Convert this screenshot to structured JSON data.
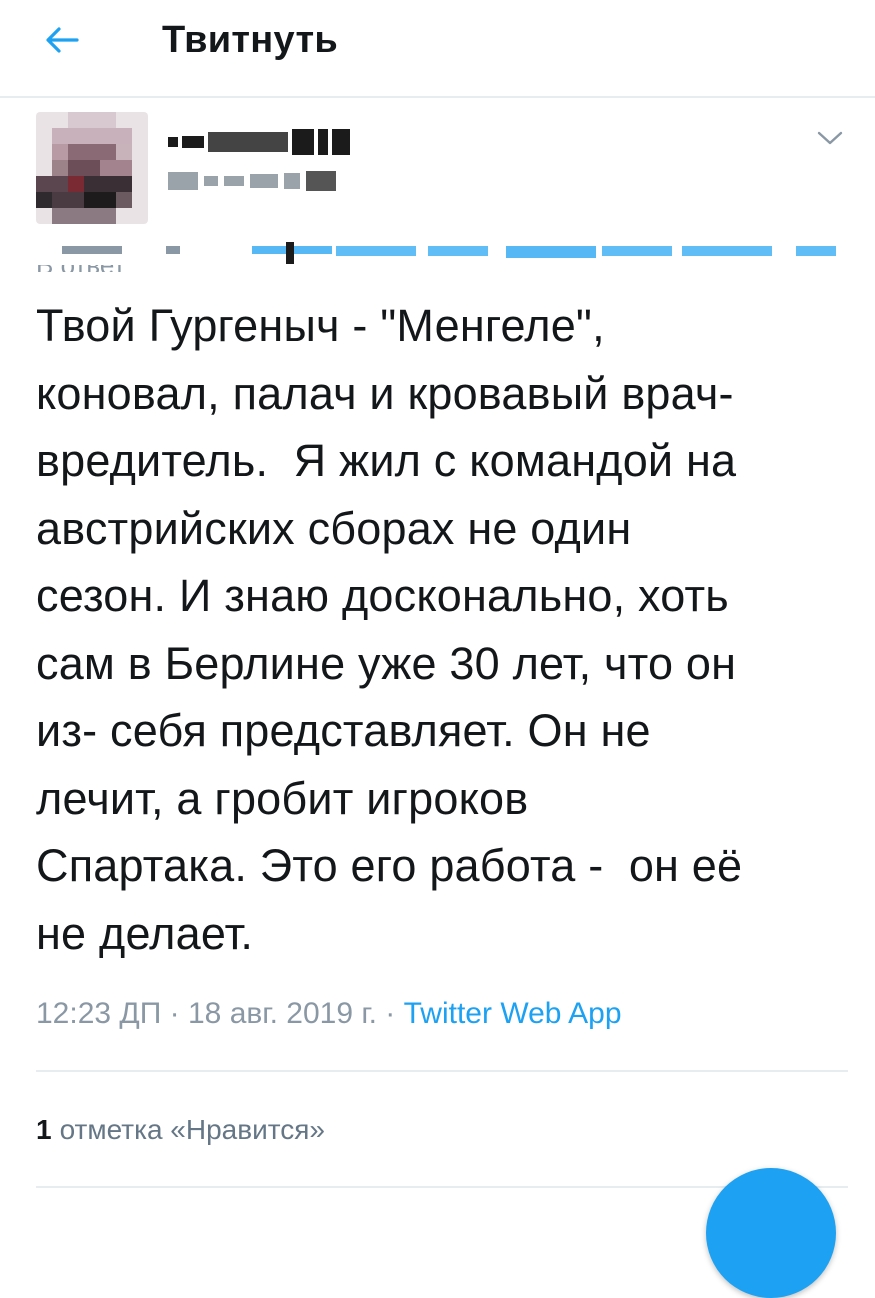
{
  "header": {
    "title": "Твитнуть",
    "back_icon": "arrow-left-icon"
  },
  "tweet": {
    "reply_label": "В ответ",
    "text": "Твой Гургеныч - \"Менгеле\",\nконовал, палач и кровавый врач-\nвредитель.  Я жил с командой на\nавстрийских сборах не один\nсезон. И знаю досконально, хоть\nсам в Берлине уже 30 лет, что он\nиз- себя представляет. Он не\nлечит, а гробит игроков\nСпартака. Это его работа -  он её\nне делает.",
    "time": "12:23 ДП",
    "separator": "·",
    "date": "18 авг. 2019 г.",
    "source": "Twitter Web App"
  },
  "engagement": {
    "likes_count": "1",
    "likes_label": "отметка «Нравится»"
  },
  "colors": {
    "accent": "#1da1f2",
    "text": "#14171a",
    "muted": "#8a98a5",
    "divider": "#e6ecf0"
  }
}
